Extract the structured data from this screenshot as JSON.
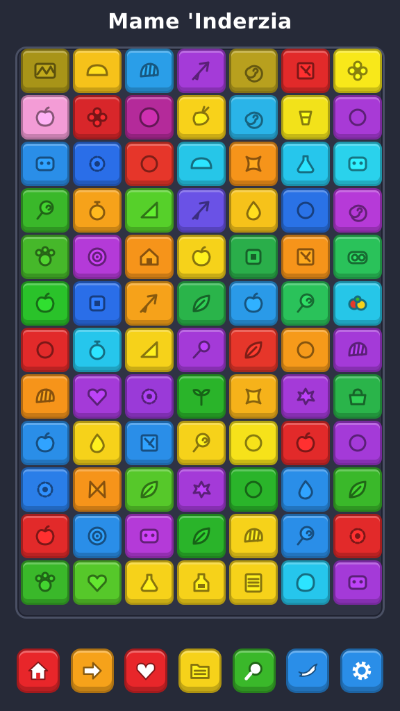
{
  "title": "Mame 'Inderzia",
  "board": {
    "columns": 7,
    "rows": [
      [
        {
          "color": "#a89418",
          "icon": "wave"
        },
        {
          "color": "#f6c21a",
          "icon": "bread"
        },
        {
          "color": "#2a9ee8",
          "icon": "shell"
        },
        {
          "color": "#a43bd8",
          "icon": "arrow"
        },
        {
          "color": "#b8a01e",
          "icon": "spiral"
        },
        {
          "color": "#e22a2a",
          "icon": "frame"
        },
        {
          "color": "#f8e81a",
          "icon": "flower"
        }
      ],
      [
        {
          "color": "#f39cd6",
          "icon": "apple"
        },
        {
          "color": "#d8262a",
          "icon": "flower"
        },
        {
          "color": "#b42a9a",
          "icon": "circle"
        },
        {
          "color": "#f8d21a",
          "icon": "carrot"
        },
        {
          "color": "#2ab4e8",
          "icon": "spiral"
        },
        {
          "color": "#f2e21a",
          "icon": "bell"
        },
        {
          "color": "#a83ad6",
          "icon": "ring"
        }
      ],
      [
        {
          "color": "#2a8ee8",
          "icon": "face"
        },
        {
          "color": "#2a6ee8",
          "icon": "gear"
        },
        {
          "color": "#e6362a",
          "icon": "ring"
        },
        {
          "color": "#26c6e8",
          "icon": "bread"
        },
        {
          "color": "#f6941a",
          "icon": "star"
        },
        {
          "color": "#26c6ec",
          "icon": "potion"
        },
        {
          "color": "#2ad2ec",
          "icon": "face"
        }
      ],
      [
        {
          "color": "#3ab82a",
          "icon": "lollipop"
        },
        {
          "color": "#f6a21a",
          "icon": "bomb"
        },
        {
          "color": "#56d02a",
          "icon": "triangle"
        },
        {
          "color": "#6a52e6",
          "icon": "arrow"
        },
        {
          "color": "#f6c21a",
          "icon": "drop"
        },
        {
          "color": "#2a72e6",
          "icon": "ring"
        },
        {
          "color": "#b63ad8",
          "icon": "spiral"
        }
      ],
      [
        {
          "color": "#46b82a",
          "icon": "paw"
        },
        {
          "color": "#b43ad8",
          "icon": "target"
        },
        {
          "color": "#f6941a",
          "icon": "house"
        },
        {
          "color": "#f6d21a",
          "icon": "apple"
        },
        {
          "color": "#2aae4a",
          "icon": "square"
        },
        {
          "color": "#f6941a",
          "icon": "frame"
        },
        {
          "color": "#2ac25a",
          "icon": "camera"
        }
      ],
      [
        {
          "color": "#2ac22a",
          "icon": "apple"
        },
        {
          "color": "#2a6ee8",
          "icon": "square"
        },
        {
          "color": "#f6a21a",
          "icon": "arrow"
        },
        {
          "color": "#2ab44a",
          "icon": "leaf"
        },
        {
          "color": "#2a9ae8",
          "icon": "apple"
        },
        {
          "color": "#2ac25a",
          "icon": "lollipop"
        },
        {
          "color": "#26c6e8",
          "icon": "fruit"
        }
      ],
      [
        {
          "color": "#e22a2a",
          "icon": "ring"
        },
        {
          "color": "#26c6ec",
          "icon": "bomb"
        },
        {
          "color": "#f6d21a",
          "icon": "triangle"
        },
        {
          "color": "#a43ad8",
          "icon": "key"
        },
        {
          "color": "#e6362a",
          "icon": "leaf"
        },
        {
          "color": "#f69a1a",
          "icon": "ring"
        },
        {
          "color": "#a43ad8",
          "icon": "shell"
        }
      ],
      [
        {
          "color": "#f6941a",
          "icon": "shell"
        },
        {
          "color": "#a43ad8",
          "icon": "heart"
        },
        {
          "color": "#9a3ad8",
          "icon": "gear"
        },
        {
          "color": "#2ab42a",
          "icon": "sprout"
        },
        {
          "color": "#f6b21a",
          "icon": "star"
        },
        {
          "color": "#a43ad8",
          "icon": "splash"
        },
        {
          "color": "#2ab44a",
          "icon": "pot"
        }
      ],
      [
        {
          "color": "#2a8ee8",
          "icon": "apple"
        },
        {
          "color": "#f6d21a",
          "icon": "drop"
        },
        {
          "color": "#2a8ee8",
          "icon": "frame"
        },
        {
          "color": "#f6d21a",
          "icon": "lollipop"
        },
        {
          "color": "#f6e21a",
          "icon": "ring"
        },
        {
          "color": "#e22a2a",
          "icon": "apple"
        },
        {
          "color": "#a43ad8",
          "icon": "ring"
        }
      ],
      [
        {
          "color": "#2a7ee8",
          "icon": "gear"
        },
        {
          "color": "#f6941a",
          "icon": "bow"
        },
        {
          "color": "#56c82a",
          "icon": "leaf"
        },
        {
          "color": "#a43ad8",
          "icon": "splash"
        },
        {
          "color": "#2ab42a",
          "icon": "ring"
        },
        {
          "color": "#2a8ee8",
          "icon": "drop"
        },
        {
          "color": "#3ab82a",
          "icon": "leaf"
        }
      ],
      [
        {
          "color": "#e22a2a",
          "icon": "apple"
        },
        {
          "color": "#2a8ee8",
          "icon": "target"
        },
        {
          "color": "#b43ad8",
          "icon": "face"
        },
        {
          "color": "#2ab42a",
          "icon": "leaf"
        },
        {
          "color": "#f6d21a",
          "icon": "shell"
        },
        {
          "color": "#2a8ee8",
          "icon": "lollipop"
        },
        {
          "color": "#e22a2a",
          "icon": "gear"
        }
      ],
      [
        {
          "color": "#3ab82a",
          "icon": "paw"
        },
        {
          "color": "#56c82a",
          "icon": "heart"
        },
        {
          "color": "#f6d21a",
          "icon": "potion"
        },
        {
          "color": "#f6d21a",
          "icon": "bottle"
        },
        {
          "color": "#f6d21a",
          "icon": "list"
        },
        {
          "color": "#26c6ec",
          "icon": "blob"
        },
        {
          "color": "#a43ad8",
          "icon": "face"
        }
      ]
    ]
  },
  "toolbar": [
    {
      "name": "home",
      "color": "#e8262a",
      "icon": "house"
    },
    {
      "name": "next",
      "color": "#f6a21a",
      "icon": "arrow-right"
    },
    {
      "name": "favorite",
      "color": "#e8262a",
      "icon": "heart"
    },
    {
      "name": "files",
      "color": "#f6d21a",
      "icon": "folder"
    },
    {
      "name": "search",
      "color": "#3ab82a",
      "icon": "search"
    },
    {
      "name": "social",
      "color": "#2a8ee8",
      "icon": "bird"
    },
    {
      "name": "settings",
      "color": "#2a8ee8",
      "icon": "gear"
    }
  ]
}
